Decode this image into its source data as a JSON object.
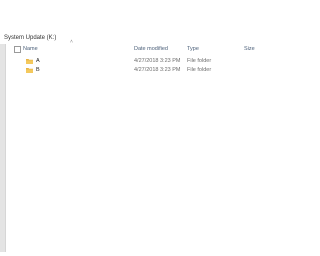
{
  "address_bar": {
    "path_text": "System Update (K:)"
  },
  "columns": {
    "name": "Name",
    "date_modified": "Date modified",
    "type": "Type",
    "size": "Size"
  },
  "sort_indicator": "˄",
  "files": [
    {
      "name": "A",
      "date_modified": "4/27/2018 3:23 PM",
      "type": "File folder",
      "icon": "folder-icon"
    },
    {
      "name": "B",
      "date_modified": "4/27/2018 3:23 PM",
      "type": "File folder",
      "icon": "folder-icon"
    }
  ],
  "colors": {
    "folder": "#e8b443",
    "header_text": "#4c607a"
  }
}
